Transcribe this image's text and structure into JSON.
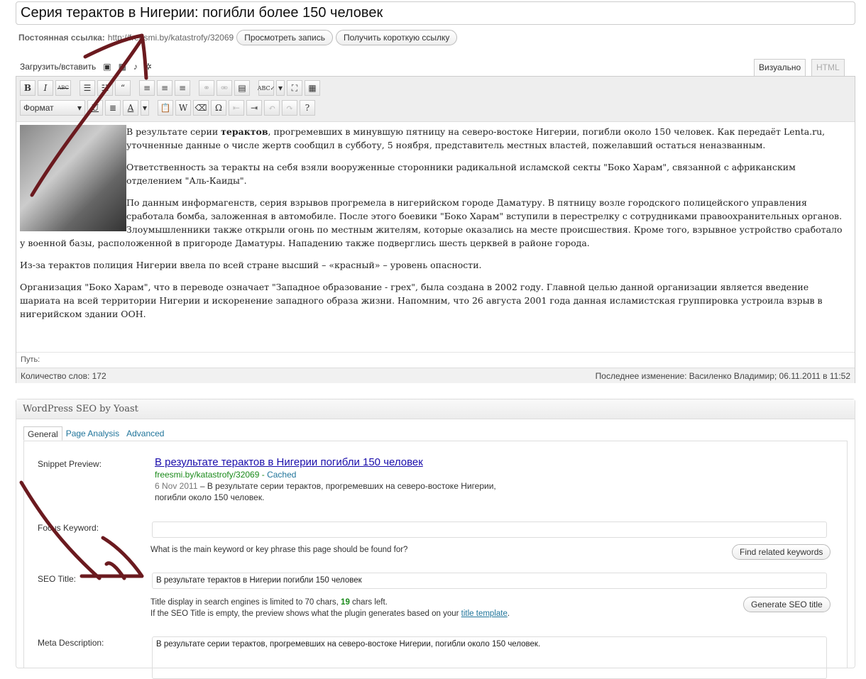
{
  "post_title": "Серия терактов в Нигерии: погибли более 150 человек",
  "permalink": {
    "label": "Постоянная ссылка:",
    "url": "http://freesmi.by/katastrofy/32069",
    "view_button": "Просмотреть запись",
    "shortlink_button": "Получить короткую ссылку"
  },
  "upload_label": "Загрузить/вставить",
  "editor_tabs": {
    "visual": "Визуально",
    "html": "HTML"
  },
  "toolbar": {
    "format_select": "Формат"
  },
  "content": {
    "p1_a": "В результате серии ",
    "p1_bold": "терактов",
    "p1_b": ", прогремевших  в минувшую пятницу на северо-востоке Нигерии, погибли около 150 человек. Как передаёт Lenta.ru, уточненные данные о числе жертв сообщил в субботу, 5 ноября, представитель местных властей, пожелавший остаться неназванным.",
    "p2": "Ответственность за теракты на себя взяли вооруженные сторонники радикальной исламской секты \"Боко Харам\", связанной с африканским отделением \"Аль-Каиды\".",
    "p3": "По данным информагенств, серия взрывов прогремела в нигерийском городе Даматуру. В пятницу возле городского полицейского управления сработала бомба,  заложенная в автомобиле. После этого боевики \"Боко Харам\" вступили в перестрелку с сотрудниками правоохранительных органов. Злоумышленники также открыли огонь по местным жителям, которые оказались на месте происшествия. Кроме того, взрывное устройство сработало у военной базы, расположенной в пригороде Даматуры. Нападению также подверглись шесть церквей в районе города.",
    "p4": "Из-за терактов полиция Нигерии ввела по всей стране высший – «красный» – уровень опасности.",
    "p5": "Организация \"Боко Харам\", что в переводе означает  \"Западное образование - грех\", была создана в 2002 году.  Главной целью данной организации является введение шариата на всей территории Нигерии и искоренение западного образа жизни. Напомним, что 26 августа 2001 года данная исламистская группировка устроила взрыв в нигерийском здании ООН."
  },
  "path_label": "Путь:",
  "word_count": "Количество слов: 172",
  "last_modified": "Последнее изменение: Василенко Владимир; 06.11.2011 в 11:52",
  "seo": {
    "header": "WordPress SEO by Yoast",
    "tabs": [
      "General",
      "Page Analysis",
      "Advanced"
    ],
    "snippet_label": "Snippet Preview:",
    "snippet_title": "В результате терактов в Нигерии погибли 150 человек",
    "snippet_url": "freesmi.by/katastrofy/32069",
    "snippet_cached": "Cached",
    "snippet_date": "6 Nov 2011",
    "snippet_desc": " – В результате серии терактов, прогремевших на северо-востоке Нигерии,",
    "snippet_desc2": "погибли около 150 человек.",
    "focus_label": "Focus Keyword:",
    "focus_value": "",
    "focus_hint": "What is the main keyword or key phrase this page should be found for?",
    "find_button": "Find related keywords",
    "title_label": "SEO Title:",
    "title_value": "В результате терактов в Нигерии погибли 150 человек",
    "title_hint_a": "Title display in search engines is limited to 70 chars, ",
    "title_chars_left": "19",
    "title_hint_b": " chars left.",
    "title_hint2": "If the SEO Title is empty, the preview shows what the plugin generates based on your ",
    "title_template_link": "title template",
    "generate_button": "Generate SEO title",
    "meta_label": "Meta Description:",
    "meta_value": "В результате серии терактов, прогремевших на северо-востоке Нигерии, погибли около 150 человек."
  },
  "colors": {
    "arrow": "#6b1a1f",
    "link": "#21759b",
    "green": "#1a8a1a"
  }
}
